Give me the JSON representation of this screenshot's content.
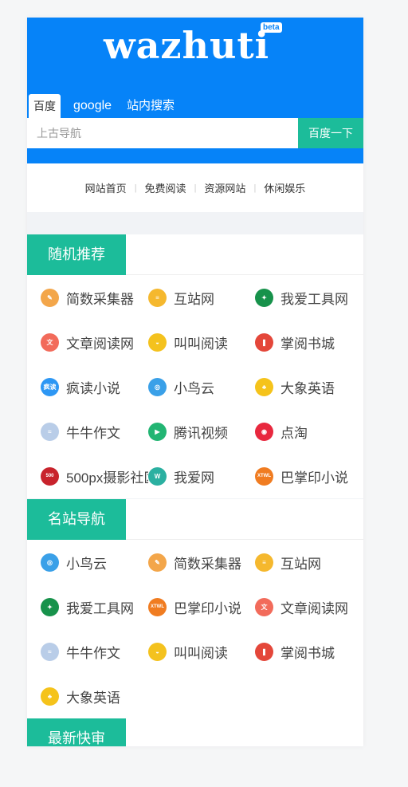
{
  "header": {
    "logo": "wazhuti",
    "beta": "beta",
    "tabs": [
      "百度",
      "google",
      "站内搜索"
    ],
    "search_placeholder": "上古导航",
    "search_button": "百度一下",
    "brand_color": "#0683f8",
    "accent_color": "#1cbc9a"
  },
  "nav": [
    "网站首页",
    "免费阅读",
    "资源网站",
    "休闲娱乐"
  ],
  "random": {
    "title": "随机推荐",
    "items": [
      {
        "label": "简数采集器",
        "icon": "brush-icon",
        "color": "#f3a64a",
        "glyph": "✎"
      },
      {
        "label": "互站网",
        "icon": "stack-icon",
        "color": "#f5b82e",
        "glyph": "≡"
      },
      {
        "label": "我爱工具网",
        "icon": "wrench-icon",
        "color": "#17924b",
        "glyph": "✦"
      },
      {
        "label": "文章阅读网",
        "icon": "wen-icon",
        "color": "#f26b5b",
        "glyph": "文"
      },
      {
        "label": "叫叫阅读",
        "icon": "bowl-icon",
        "color": "#f4c21e",
        "glyph": "◒"
      },
      {
        "label": "掌阅书城",
        "icon": "book-icon",
        "color": "#e4473a",
        "glyph": "❚"
      },
      {
        "label": "疯读小说",
        "icon": "fengdu-icon",
        "color": "#2d97f4",
        "glyph": "疯读"
      },
      {
        "label": "小鸟云",
        "icon": "swirl-icon",
        "color": "#3aa0e8",
        "glyph": "◎"
      },
      {
        "label": "大象英语",
        "icon": "elephant-icon",
        "color": "#f5c31b",
        "glyph": "♣"
      },
      {
        "label": "牛牛作文",
        "icon": "niuniu-icon",
        "color": "#b9cde8",
        "glyph": "≈"
      },
      {
        "label": "腾讯视频",
        "icon": "play-icon",
        "color": "#22b573",
        "glyph": "▶"
      },
      {
        "label": "点淘",
        "icon": "diantao-icon",
        "color": "#e8283e",
        "glyph": "◉"
      },
      {
        "label": "500px摄影社区",
        "icon": "500px-icon",
        "color": "#c8232c",
        "glyph": "500"
      },
      {
        "label": "我爱网",
        "icon": "w-icon",
        "color": "#2bb0a1",
        "glyph": "W"
      },
      {
        "label": "巴掌印小说",
        "icon": "xtwl-icon",
        "color": "#f07c21",
        "glyph": "XTWL"
      }
    ]
  },
  "famous": {
    "title": "名站导航",
    "items": [
      {
        "label": "小鸟云",
        "icon": "swirl-icon",
        "color": "#3aa0e8",
        "glyph": "◎"
      },
      {
        "label": "简数采集器",
        "icon": "brush-icon",
        "color": "#f3a64a",
        "glyph": "✎"
      },
      {
        "label": "互站网",
        "icon": "stack-icon",
        "color": "#f5b82e",
        "glyph": "≡"
      },
      {
        "label": "我爱工具网",
        "icon": "wrench-icon",
        "color": "#17924b",
        "glyph": "✦"
      },
      {
        "label": "巴掌印小说",
        "icon": "xtwl-icon",
        "color": "#f07c21",
        "glyph": "XTWL"
      },
      {
        "label": "文章阅读网",
        "icon": "wen-icon",
        "color": "#f26b5b",
        "glyph": "文"
      },
      {
        "label": "牛牛作文",
        "icon": "niuniu-icon",
        "color": "#b9cde8",
        "glyph": "≈"
      },
      {
        "label": "叫叫阅读",
        "icon": "bowl-icon",
        "color": "#f4c21e",
        "glyph": "◒"
      },
      {
        "label": "掌阅书城",
        "icon": "book-icon",
        "color": "#e4473a",
        "glyph": "❚"
      },
      {
        "label": "大象英语",
        "icon": "elephant-icon",
        "color": "#f5c31b",
        "glyph": "♣"
      }
    ]
  },
  "latest": {
    "title": "最新快审"
  }
}
